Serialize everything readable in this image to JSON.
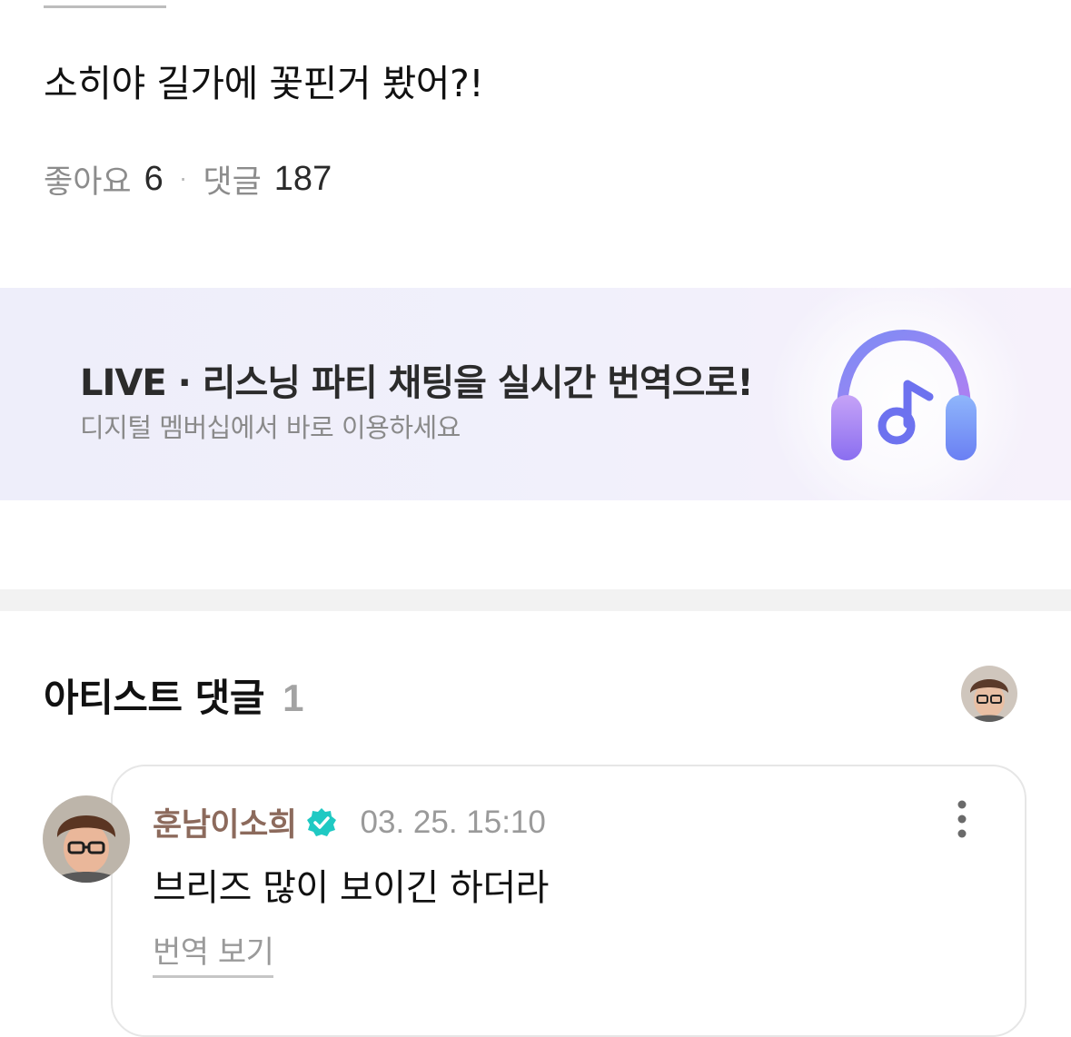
{
  "post": {
    "text": "소히야 길가에 꽃핀거 봤어?!",
    "likes_label": "좋아요",
    "likes_count": "6",
    "separator": "·",
    "comments_label": "댓글",
    "comments_count": "187"
  },
  "banner": {
    "title": "LIVE · 리스닝 파티 채팅을 실시간 번역으로!",
    "subtitle": "디지털 멤버십에서 바로 이용하세요",
    "icon": "headphones-music-icon"
  },
  "artist_comments": {
    "title": "아티스트 댓글",
    "count": "1"
  },
  "comment": {
    "author": "훈남이소희",
    "verified_icon": "verified-check-icon",
    "timestamp": "03. 25. 15:10",
    "text": "브리즈 많이 보이긴 하더라",
    "translate_label": "번역 보기"
  },
  "colors": {
    "author_name": "#8c6a5c",
    "verified": "#1fc9c3",
    "banner_bg": "#eeeefa",
    "headphone_gradient_start": "#7b7cf2",
    "headphone_gradient_end": "#b28cf5"
  }
}
